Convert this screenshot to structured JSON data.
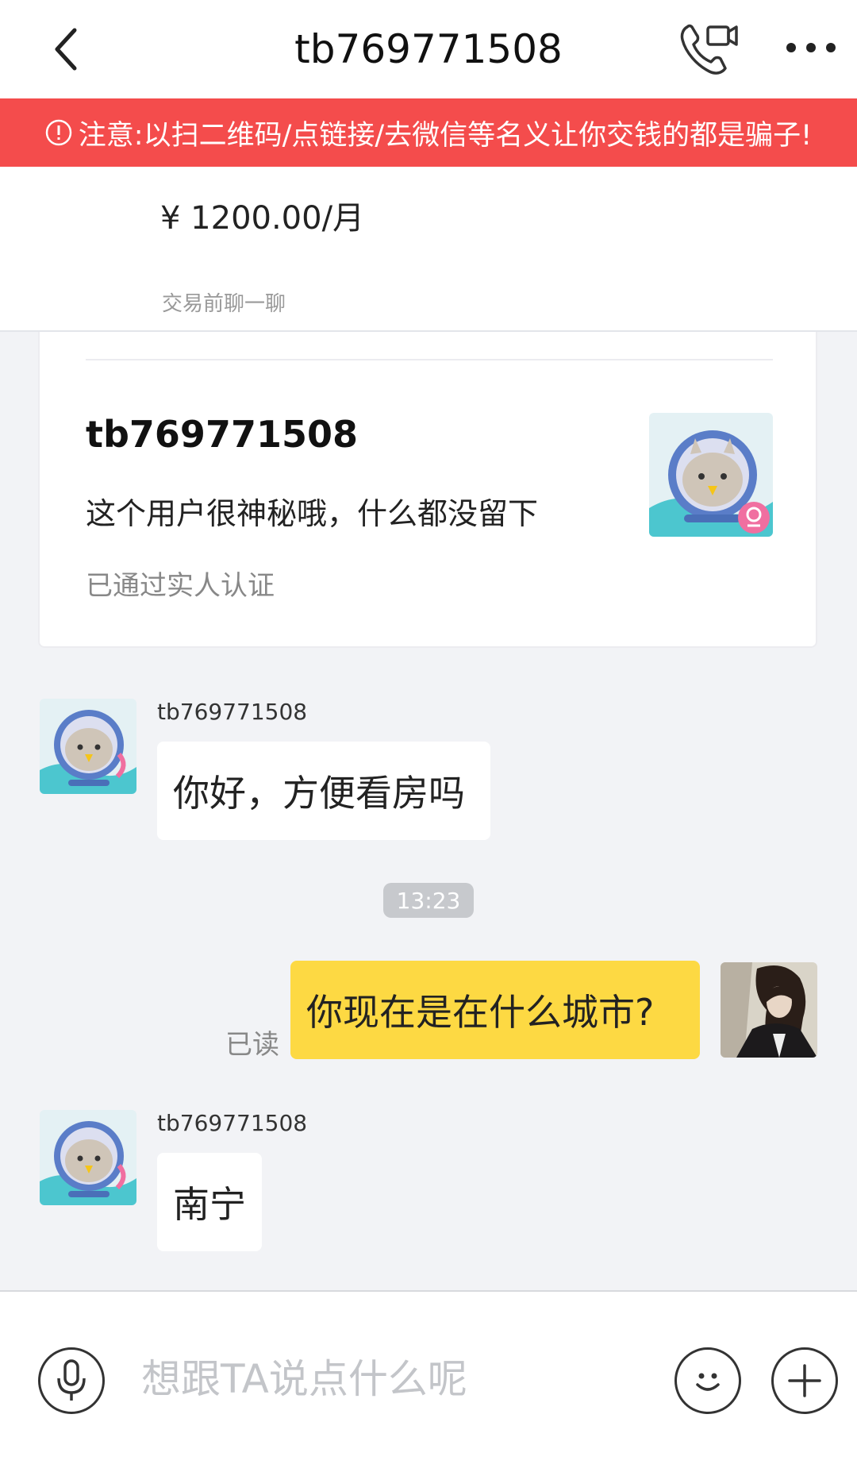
{
  "header": {
    "title": "tb769771508"
  },
  "warning": {
    "text": "注意:以扫二维码/点链接/去微信等名义让你交钱的都是骗子!"
  },
  "listing": {
    "price": "¥ 1200.00/月",
    "subtitle": "交易前聊一聊"
  },
  "profile": {
    "name": "tb769771508",
    "bio": "这个用户很神秘哦，什么都没留下",
    "verified": "已通过实人认证"
  },
  "messages": [
    {
      "sender": "tb769771508",
      "text": "你好，方便看房吗"
    },
    {
      "time": "13:23"
    },
    {
      "text": "你现在是在什么城市?",
      "status": "已读"
    },
    {
      "sender": "tb769771508",
      "text": "南宁"
    }
  ],
  "input": {
    "placeholder": "想跟TA说点什么呢"
  },
  "colors": {
    "warning_bg": "#f44c4c",
    "my_bubble": "#fdd943",
    "background": "#f2f3f6"
  }
}
